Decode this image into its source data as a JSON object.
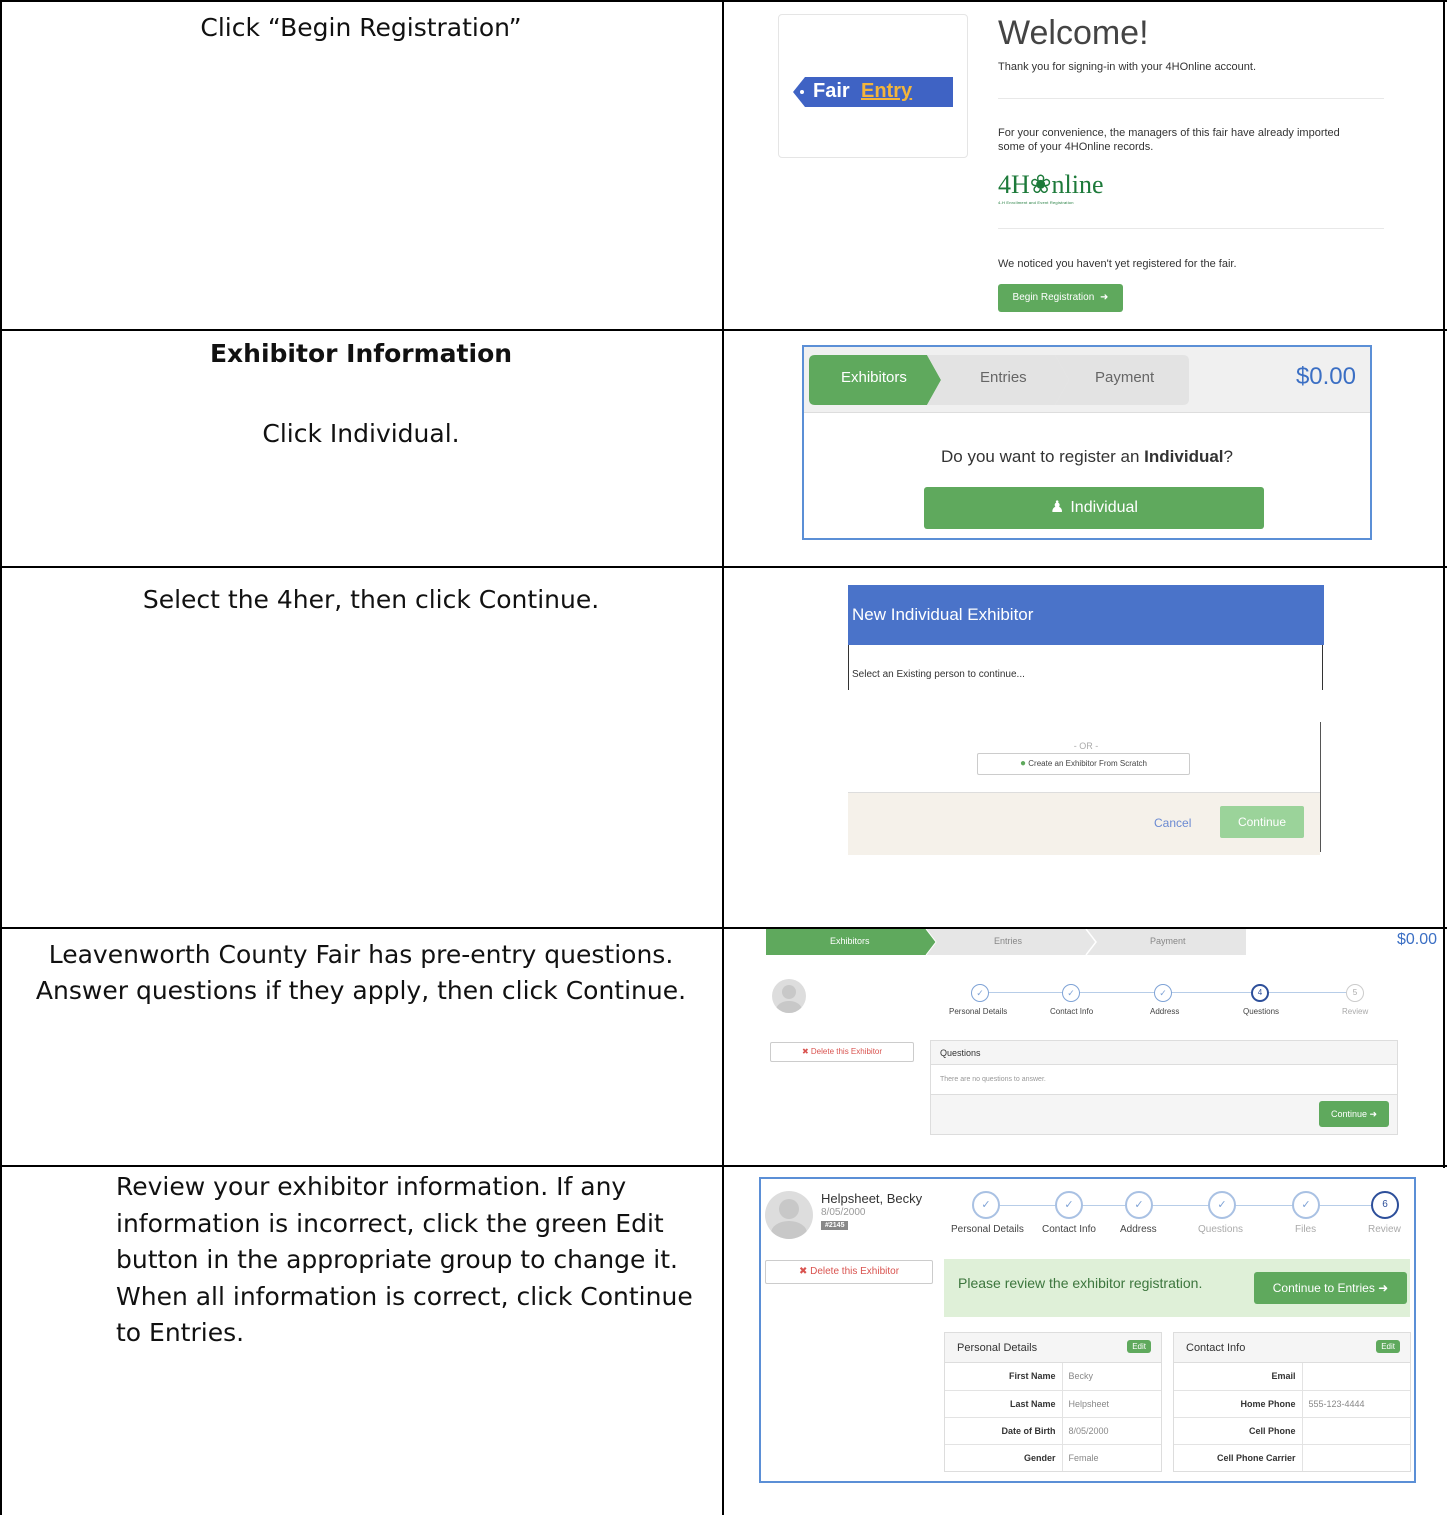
{
  "rows": [
    {
      "instruction": "Click “Begin Registration”"
    },
    {
      "heading": "Exhibitor Information",
      "instruction": "Click Individual."
    },
    {
      "instruction": "Select the 4her, then click Continue."
    },
    {
      "instruction": "Leavenworth County Fair has pre-entry questions. Answer questions if they apply, then click Continue."
    },
    {
      "instruction": "Review your exhibitor information. If any information is incorrect, click the green Edit button in the appropriate group to change it. When all information is correct, click Continue to Entries."
    }
  ],
  "welcome": {
    "logo_fair": "Fair",
    "logo_entry": "Entry",
    "title": "Welcome!",
    "thanks": "Thank you for signing-in with your 4HOnline account.",
    "convenience": "For your convenience, the managers of this fair have already imported some of your 4HOnline records.",
    "brand": "4H❀nline",
    "brand_sub": "4-H Enrollment and Event Registration",
    "notice": "We noticed you haven't yet registered for the fair.",
    "begin_button": "Begin Registration"
  },
  "steps": {
    "exhibitors": "Exhibitors",
    "entries": "Entries",
    "payment": "Payment",
    "total": "$0.00",
    "question_pre": "Do you want to register an ",
    "question_bold": "Individual",
    "question_post": "?",
    "individual_button": "Individual"
  },
  "modal": {
    "title": "New Individual Exhibitor",
    "select_text": "Select an Existing person to continue...",
    "or": "- OR -",
    "create_button": "Create an Exhibitor From Scratch",
    "cancel": "Cancel",
    "continue": "Continue"
  },
  "questions": {
    "exhibitors": "Exhibitors",
    "entries": "Entries",
    "payment": "Payment",
    "total": "$0.00",
    "delete_button": "Delete this Exhibitor",
    "progress": [
      "Personal Details",
      "Contact Info",
      "Address",
      "Questions",
      "Review"
    ],
    "step_four": "4",
    "step_five": "5",
    "panel_title": "Questions",
    "panel_empty": "There are no questions to answer.",
    "continue_button": "Continue"
  },
  "review": {
    "name": "Helpsheet, Becky",
    "dob": "8/05/2000",
    "badge": "#2145",
    "delete_button": "Delete this Exhibitor",
    "progress": [
      "Personal Details",
      "Contact Info",
      "Address",
      "Questions",
      "Files",
      "Review"
    ],
    "step_six": "6",
    "review_message": "Please review the exhibitor registration.",
    "continue_entries": "Continue to Entries",
    "personal_title": "Personal Details",
    "contact_title": "Contact Info",
    "edit": "Edit",
    "personal": [
      {
        "label": "First Name",
        "value": "Becky"
      },
      {
        "label": "Last Name",
        "value": "Helpsheet"
      },
      {
        "label": "Date of Birth",
        "value": "8/05/2000"
      },
      {
        "label": "Gender",
        "value": "Female"
      }
    ],
    "contact": [
      {
        "label": "Email",
        "value": ""
      },
      {
        "label": "Home Phone",
        "value": "555-123-4444"
      },
      {
        "label": "Cell Phone",
        "value": ""
      },
      {
        "label": "Cell Phone Carrier",
        "value": ""
      }
    ]
  },
  "colors": {
    "green": "#5fa95d",
    "blue_header": "#4a73c9",
    "total_blue": "#3b6fc4"
  }
}
